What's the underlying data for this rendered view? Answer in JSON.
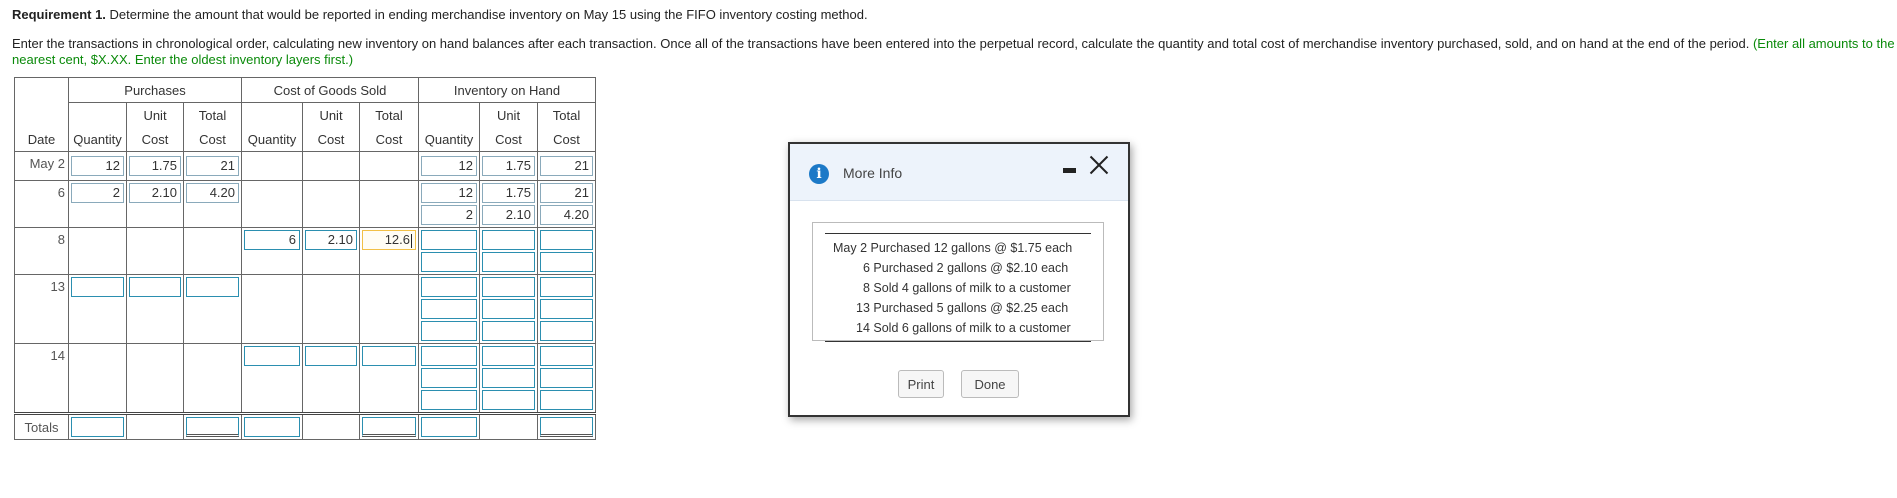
{
  "requirement": {
    "label": "Requirement 1.",
    "text": " Determine the amount that would be reported in ending merchandise inventory on May 15 using the FIFO inventory costing method."
  },
  "instructions": {
    "text": "Enter the transactions in chronological order, calculating new inventory on hand balances after each transaction. Once all of the transactions have been entered into the perpetual record, calculate the quantity and total cost of merchandise inventory purchased, sold, and on hand at the end of the period. ",
    "note": "(Enter all amounts to the nearest cent, $X.XX. Enter the oldest inventory layers first.)"
  },
  "table": {
    "group_headers": {
      "purchases": "Purchases",
      "cogs": "Cost of Goods Sold",
      "onhand": "Inventory on Hand"
    },
    "sub_top": {
      "unit": "Unit",
      "total": "Total"
    },
    "col_headers": {
      "date": "Date",
      "quantity": "Quantity",
      "cost": "Cost"
    },
    "totals_label": "Totals",
    "rows": {
      "may2": {
        "date": "May 2",
        "p_qty": "12",
        "p_unit": "1.75",
        "p_total": "21",
        "oh": [
          {
            "qty": "12",
            "unit": "1.75",
            "total": "21"
          }
        ]
      },
      "d6": {
        "date": "6",
        "p_qty": "2",
        "p_unit": "2.10",
        "p_total": "4.20",
        "oh": [
          {
            "qty": "12",
            "unit": "1.75",
            "total": "21"
          },
          {
            "qty": "2",
            "unit": "2.10",
            "total": "4.20"
          }
        ]
      },
      "d8": {
        "date": "8",
        "c_qty": "6",
        "c_unit": "2.10",
        "c_total": "12.6"
      },
      "d13": {
        "date": "13"
      },
      "d14": {
        "date": "14"
      }
    }
  },
  "dialog": {
    "title": "More Info",
    "lines": [
      "May 2 Purchased 12 gallons @ $1.75 each",
      "6 Purchased 2 gallons @ $2.10 each",
      "8 Sold 4 gallons of milk to a customer",
      "13 Purchased 5 gallons @ $2.25 each",
      "14 Sold 6 gallons of milk to a customer"
    ],
    "print_label": "Print",
    "done_label": "Done"
  },
  "colors": {
    "note_green": "#0a8a0a",
    "input_border": "#2b8fb0",
    "active_border": "#f2c046",
    "info_blue": "#1c79c7"
  }
}
